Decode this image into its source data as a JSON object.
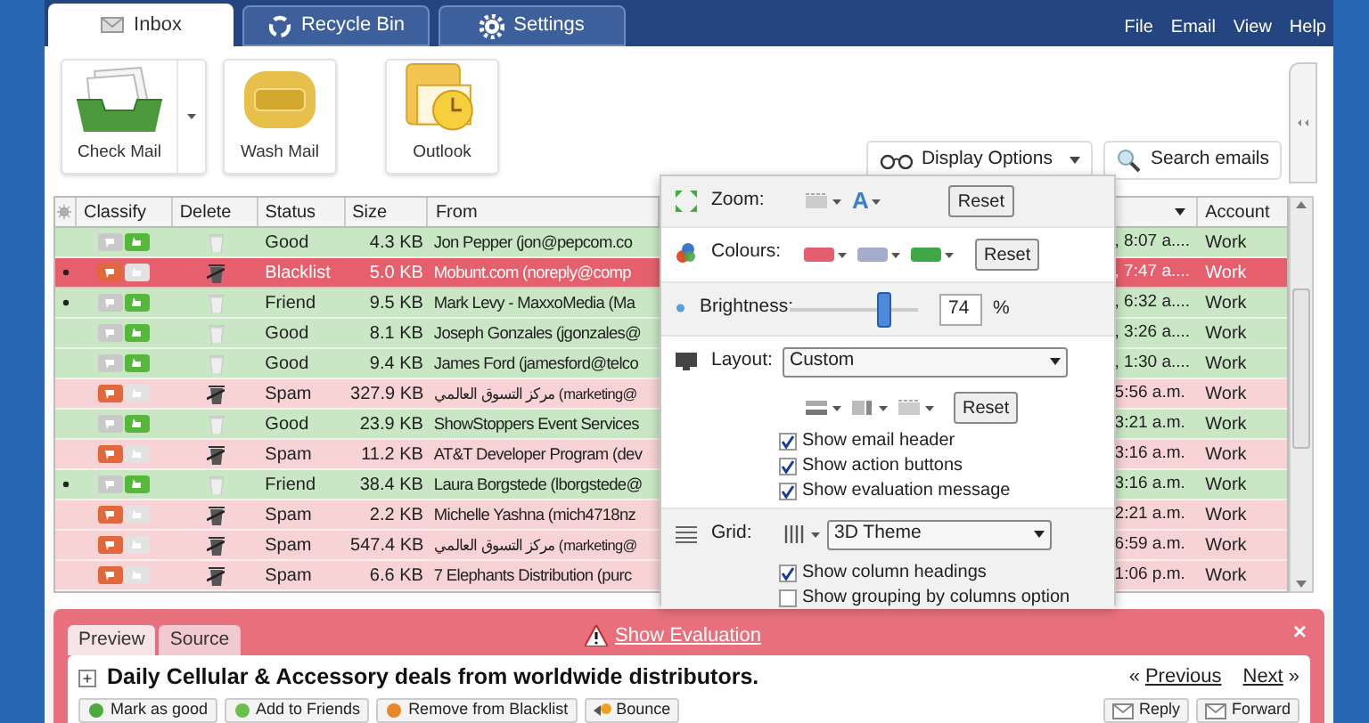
{
  "tabs": [
    {
      "label": "Inbox",
      "kind": "inbox",
      "selected": true
    },
    {
      "label": "Recycle Bin",
      "kind": "recycle",
      "selected": false
    },
    {
      "label": "Settings",
      "kind": "settings",
      "selected": false
    }
  ],
  "menu": [
    "File",
    "Email",
    "View",
    "Help"
  ],
  "toolbar": [
    {
      "label": "Check Mail",
      "kind": "inbox",
      "dropdown": true
    },
    {
      "label": "Wash Mail",
      "kind": "soap",
      "dropdown": false
    },
    {
      "label": "Outlook",
      "kind": "clock",
      "dropdown": false
    }
  ],
  "display_options": {
    "label": "Display Options"
  },
  "search": {
    "label": "Search emails"
  },
  "table": {
    "columns": [
      "Classify",
      "Delete",
      "Status",
      "Size",
      "From",
      "Account"
    ],
    "rows": [
      {
        "kind": "good",
        "flagged": false,
        "status": "Good",
        "size": "4.3 KB",
        "from": "Jon Pepper (jon@pepcom.co",
        "date": ", 8:07 a....",
        "account": "Work"
      },
      {
        "kind": "blacklist",
        "flagged": true,
        "status": "Blacklist",
        "size": "5.0 KB",
        "from": "Mobunt.com (noreply@comp",
        "date": ", 7:47 a....",
        "account": "Work"
      },
      {
        "kind": "good",
        "flagged": true,
        "status": "Friend",
        "size": "9.5 KB",
        "from": "Mark Levy - MaxxoMedia (Ma",
        "date": ", 6:32 a....",
        "account": "Work"
      },
      {
        "kind": "good",
        "flagged": false,
        "status": "Good",
        "size": "8.1 KB",
        "from": "Joseph Gonzales (jgonzales@",
        "date": ", 3:26 a....",
        "account": "Work"
      },
      {
        "kind": "good",
        "flagged": false,
        "status": "Good",
        "size": "9.4 KB",
        "from": "James Ford (jamesford@telco",
        "date": ", 1:30 a....",
        "account": "Work"
      },
      {
        "kind": "spam",
        "flagged": false,
        "status": "Spam",
        "size": "327.9 KB",
        "from": "مركز التسوق العالمي (marketing@",
        "date": "5:56 a.m.",
        "account": "Work"
      },
      {
        "kind": "good",
        "flagged": false,
        "status": "Good",
        "size": "23.9 KB",
        "from": "ShowStoppers Event Services",
        "date": "3:21 a.m.",
        "account": "Work"
      },
      {
        "kind": "spam",
        "flagged": false,
        "status": "Spam",
        "size": "11.2 KB",
        "from": "AT&T Developer Program (dev",
        "date": "3:16 a.m.",
        "account": "Work"
      },
      {
        "kind": "good",
        "flagged": true,
        "status": "Friend",
        "size": "38.4 KB",
        "from": "Laura Borgstede (lborgstede@",
        "date": "3:16 a.m.",
        "account": "Work"
      },
      {
        "kind": "spam",
        "flagged": false,
        "status": "Spam",
        "size": "2.2 KB",
        "from": "Michelle Yashna (mich4718nz",
        "date": "2:21 a.m.",
        "account": "Work"
      },
      {
        "kind": "spam",
        "flagged": false,
        "status": "Spam",
        "size": "547.4 KB",
        "from": "مركز التسوق العالمي (marketing@",
        "date": "6:59 a.m.",
        "account": "Work"
      },
      {
        "kind": "spam",
        "flagged": false,
        "status": "Spam",
        "size": "6.6 KB",
        "from": "7 Elephants Distribution (purc",
        "date": "1:06 p.m.",
        "account": "Work"
      }
    ]
  },
  "display_panel": {
    "zoom": {
      "label": "Zoom:",
      "font_button": "A",
      "reset": "Reset"
    },
    "colours": {
      "label": "Colours:",
      "swatches": [
        {
          "color": "#e35f6e"
        },
        {
          "color": "#a3acc9"
        },
        {
          "color": "#3fa845"
        }
      ],
      "reset": "Reset"
    },
    "brightness": {
      "label": "Brightness:",
      "level": 0.74,
      "value": "74",
      "unit": "%"
    },
    "layout": {
      "label": "Layout:",
      "select": "Custom",
      "reset": "Reset",
      "options": [
        {
          "label": "Show email header",
          "checked": true
        },
        {
          "label": "Show action buttons",
          "checked": true
        },
        {
          "label": "Show evaluation message",
          "checked": true
        }
      ]
    },
    "grid": {
      "label": "Grid:",
      "select": "3D Theme",
      "options": [
        {
          "label": "Show column headings",
          "checked": true
        },
        {
          "label": "Show grouping by columns option",
          "checked": false
        }
      ]
    }
  },
  "preview_tabs": [
    {
      "label": "Preview",
      "selected": true
    },
    {
      "label": "Source",
      "selected": false
    }
  ],
  "evaluation": {
    "link": "Show Evaluation",
    "close": "×"
  },
  "message": {
    "expand": "+",
    "subject": "Daily Cellular & Accessory deals from worldwide distributors.",
    "previous": {
      "arrow": "«",
      "label": "Previous"
    },
    "next": {
      "arrow": "»",
      "label": "Next"
    }
  },
  "actions": [
    "Mark as good",
    "Add to Friends",
    "Remove from Blacklist",
    "Bounce"
  ],
  "reply_actions": [
    "Reply",
    "Forward"
  ]
}
